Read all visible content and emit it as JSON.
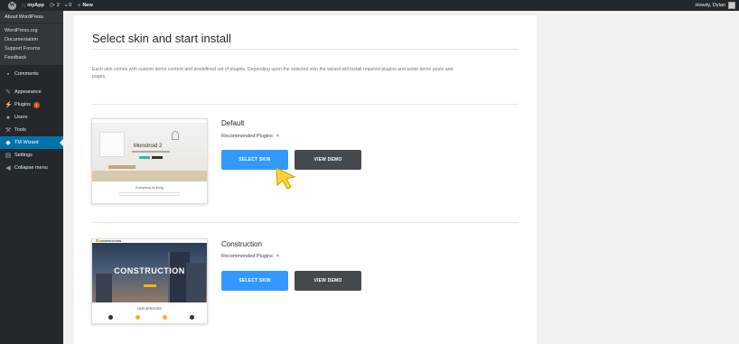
{
  "adminbar": {
    "site_name": "myApp",
    "updates_count": "2",
    "comments_count": "0",
    "new_label": "New",
    "howdy": "Howdy, Dylan"
  },
  "sidebar": {
    "top_item": "About WordPress",
    "sub_items": [
      "WordPress.org",
      "Documentation",
      "Support Forums",
      "Feedback"
    ],
    "items": [
      {
        "label": "Comments",
        "icon": "comment-icon"
      },
      {
        "label": "Appearance",
        "icon": "brush-icon"
      },
      {
        "label": "Plugins",
        "icon": "plug-icon",
        "badge": "1"
      },
      {
        "label": "Users",
        "icon": "user-icon"
      },
      {
        "label": "Tools",
        "icon": "wrench-icon"
      },
      {
        "label": "TM Wizard",
        "icon": "wizard-icon",
        "active": true
      },
      {
        "label": "Settings",
        "icon": "settings-icon"
      },
      {
        "label": "Collapse menu",
        "icon": "collapse-icon"
      }
    ]
  },
  "main": {
    "title": "Select skin and start install",
    "description": "Each skin comes with custom demo content and predefined set of plugins. Depending upon the selected skin the wizard will install required plugins and some demo posts and pages.",
    "skins": [
      {
        "name": "Default",
        "recommended_label": "Recommended Plugins",
        "select_label": "SELECT SKIN",
        "demo_label": "VIEW DEMO",
        "thumb_title": "Monstroid 2",
        "thumb_caption": "Everything for living"
      },
      {
        "name": "Construction",
        "recommended_label": "Recommended Plugins",
        "select_label": "SELECT SKIN",
        "demo_label": "VIEW DEMO",
        "thumb_title": "CONSTRUCTION",
        "thumb_logo": "CONSTRUCTION",
        "thumb_caption": "OUR SERVICES"
      }
    ]
  },
  "colors": {
    "primary": "#3399ff",
    "secondary": "#44494e",
    "sidebar": "#23282d",
    "active": "#0073aa",
    "cursor": "#ffd43b"
  }
}
